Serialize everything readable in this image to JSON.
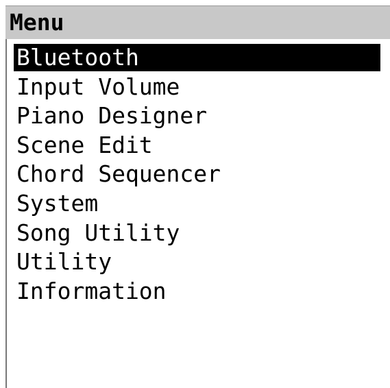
{
  "header": {
    "title": "Menu"
  },
  "menu": {
    "selected_index": 0,
    "items": [
      {
        "label": "Bluetooth"
      },
      {
        "label": "Input Volume"
      },
      {
        "label": "Piano Designer"
      },
      {
        "label": "Scene Edit"
      },
      {
        "label": "Chord Sequencer"
      },
      {
        "label": "System"
      },
      {
        "label": "Song Utility"
      },
      {
        "label": "Utility"
      },
      {
        "label": "Information"
      }
    ]
  },
  "colors": {
    "header_bg": "#c8c8c8",
    "selection_bg": "#000000",
    "selection_text": "#ffffff",
    "text": "#000000",
    "background": "#ffffff"
  }
}
